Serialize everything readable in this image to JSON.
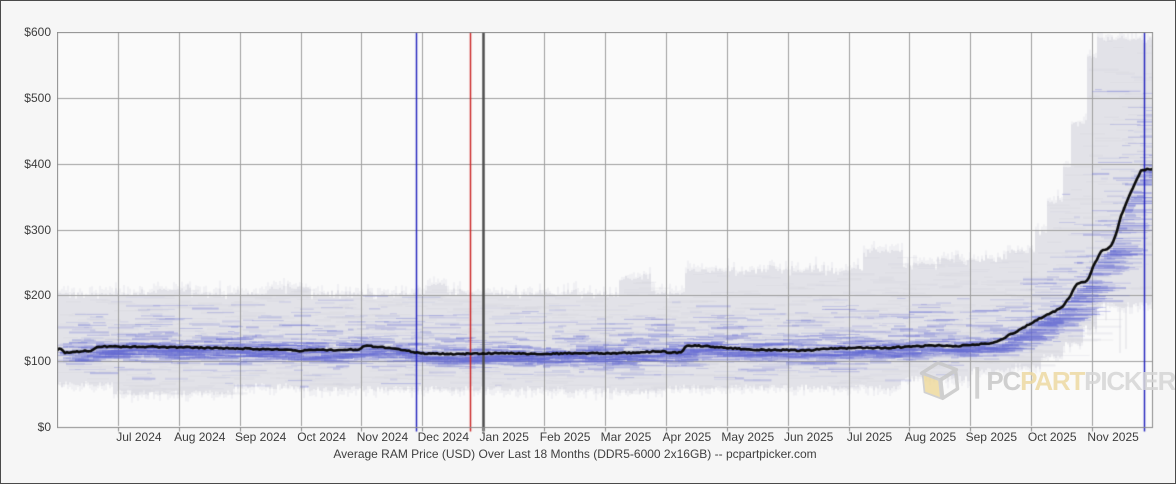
{
  "page": {
    "background": "#f6f6f6",
    "border_color": "#4a4a4a"
  },
  "chart_data": {
    "type": "line",
    "title": "Average RAM Price (USD) Over Last 18 Months (DDR5-6000 2x16GB) -- pcpartpicker.com",
    "grid": true,
    "x_axis": {
      "months_span": 18,
      "labels": [
        "Jul 2024",
        "Aug 2024",
        "Sep 2024",
        "Oct 2024",
        "Nov 2024",
        "Dec 2024",
        "Jan 2025",
        "Feb 2025",
        "Mar 2025",
        "Apr 2025",
        "May 2025",
        "Jun 2025",
        "Jul 2025",
        "Aug 2025",
        "Sep 2025",
        "Oct 2025",
        "Nov 2025"
      ]
    },
    "y_axis": {
      "labels": [
        "$600",
        "$500",
        "$400",
        "$300",
        "$200",
        "$100",
        "$0"
      ],
      "values": [
        600,
        500,
        400,
        300,
        200,
        100,
        0
      ],
      "min": 0,
      "max": 600
    },
    "series": [
      {
        "name": "average-price",
        "type": "line",
        "color": "#0b0b0b",
        "points": [
          [
            0,
            116
          ],
          [
            0.05,
            121
          ],
          [
            0.12,
            113
          ],
          [
            0.3,
            114
          ],
          [
            0.55,
            116
          ],
          [
            0.68,
            122
          ],
          [
            1.0,
            122
          ],
          [
            1.5,
            122
          ],
          [
            2.0,
            121
          ],
          [
            2.6,
            120
          ],
          [
            3.1,
            119
          ],
          [
            3.55,
            118
          ],
          [
            3.85,
            117
          ],
          [
            3.95,
            115
          ],
          [
            4.1,
            117
          ],
          [
            4.7,
            117
          ],
          [
            4.97,
            118
          ],
          [
            5.05,
            123
          ],
          [
            5.25,
            122
          ],
          [
            5.55,
            119
          ],
          [
            5.8,
            115
          ],
          [
            5.95,
            112
          ],
          [
            6.3,
            111
          ],
          [
            6.7,
            111
          ],
          [
            7.05,
            112
          ],
          [
            7.5,
            112
          ],
          [
            8.0,
            111
          ],
          [
            8.5,
            112
          ],
          [
            9.0,
            112
          ],
          [
            9.5,
            113
          ],
          [
            9.88,
            115
          ],
          [
            10.0,
            114
          ],
          [
            10.08,
            113
          ],
          [
            10.26,
            113
          ],
          [
            10.33,
            124
          ],
          [
            10.6,
            123
          ],
          [
            10.9,
            121
          ],
          [
            11.2,
            119
          ],
          [
            11.6,
            117
          ],
          [
            12.0,
            117
          ],
          [
            12.3,
            116
          ],
          [
            12.6,
            119
          ],
          [
            13.0,
            120
          ],
          [
            13.6,
            120
          ],
          [
            14.0,
            122
          ],
          [
            14.5,
            124
          ],
          [
            14.8,
            123
          ],
          [
            15.05,
            125
          ],
          [
            15.3,
            127
          ],
          [
            15.45,
            130
          ],
          [
            15.55,
            134
          ],
          [
            15.66,
            141
          ],
          [
            15.83,
            148
          ],
          [
            16.0,
            158
          ],
          [
            16.16,
            166
          ],
          [
            16.3,
            172
          ],
          [
            16.45,
            179
          ],
          [
            16.52,
            182
          ],
          [
            16.57,
            190
          ],
          [
            16.65,
            200
          ],
          [
            16.73,
            215
          ],
          [
            16.78,
            218
          ],
          [
            16.93,
            222
          ],
          [
            17.0,
            240
          ],
          [
            17.05,
            250
          ],
          [
            17.1,
            258
          ],
          [
            17.16,
            268
          ],
          [
            17.25,
            270
          ],
          [
            17.32,
            276
          ],
          [
            17.4,
            295
          ],
          [
            17.48,
            322
          ],
          [
            17.56,
            340
          ],
          [
            17.64,
            357
          ],
          [
            17.72,
            373
          ],
          [
            17.8,
            389
          ],
          [
            17.86,
            391
          ],
          [
            17.98,
            392
          ]
        ]
      },
      {
        "name": "price-range-band",
        "type": "band",
        "color": "#e0e0e6",
        "high": [
          [
            0,
            202
          ],
          [
            1.54,
            209
          ],
          [
            2.2,
            202
          ],
          [
            3.43,
            211
          ],
          [
            4.17,
            202
          ],
          [
            6.06,
            217
          ],
          [
            6.39,
            203
          ],
          [
            9.21,
            226
          ],
          [
            9.62,
            233
          ],
          [
            9.75,
            204
          ],
          [
            10.3,
            238
          ],
          [
            12.95,
            240
          ],
          [
            13.23,
            267
          ],
          [
            13.89,
            248
          ],
          [
            14.43,
            255
          ],
          [
            15.58,
            267
          ],
          [
            16.03,
            297
          ],
          [
            16.24,
            342
          ],
          [
            16.49,
            395
          ],
          [
            16.65,
            463
          ],
          [
            16.9,
            562
          ],
          [
            17.06,
            590
          ],
          [
            18,
            590
          ]
        ],
        "low": [
          [
            0,
            65
          ],
          [
            0.89,
            52
          ],
          [
            2.86,
            62
          ],
          [
            3.84,
            58
          ],
          [
            8.28,
            55
          ],
          [
            9.92,
            60
          ],
          [
            13.86,
            73
          ],
          [
            15.01,
            85
          ],
          [
            15.66,
            92
          ],
          [
            16.16,
            108
          ],
          [
            16.49,
            125
          ],
          [
            16.82,
            150
          ],
          [
            17.06,
            185
          ],
          [
            18,
            190
          ]
        ]
      },
      {
        "name": "individual-listings",
        "type": "scatter",
        "color": "#666cd4",
        "seed": 1234567,
        "description": "horizontal dashes, one per listing price sample"
      }
    ],
    "markers": [
      {
        "name": "event-line-nov-2024",
        "month": 5.9,
        "color": "#2a2ac0",
        "width": 1.5
      },
      {
        "name": "event-line-dec-2024",
        "month": 6.78,
        "color": "#cc2a2a",
        "width": 1.5
      },
      {
        "name": "year-boundary-2025",
        "month": 7.0,
        "color": "#4e4e4e",
        "width": 2.5
      },
      {
        "name": "event-line-nov-2025",
        "month": 17.85,
        "color": "#2a2ac0",
        "width": 1.5
      }
    ],
    "watermark": {
      "separator": "|",
      "brand_gray": "PC",
      "brand_gold": "PART",
      "brand_light": "PICKER"
    }
  }
}
